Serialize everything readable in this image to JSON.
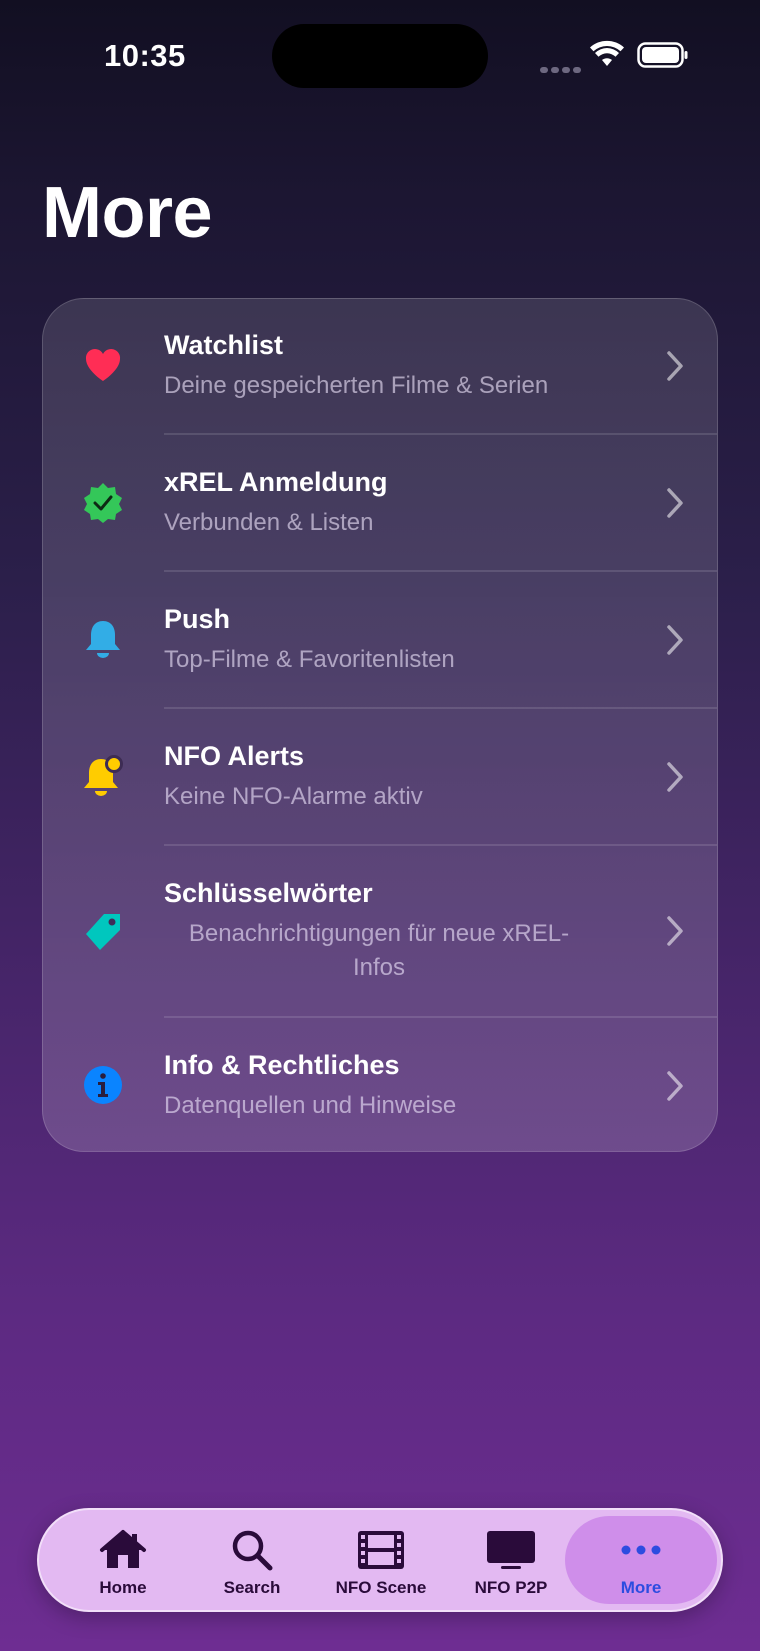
{
  "status_bar": {
    "time": "10:35",
    "icons": [
      "signal-dots-icon",
      "wifi-icon",
      "battery-icon"
    ]
  },
  "page": {
    "title": "More"
  },
  "menu": {
    "items": [
      {
        "title": "Watchlist",
        "subtitle": "Deine gespeicherten Filme & Serien",
        "icon": "heart-icon",
        "icon_color": "#ff2d55"
      },
      {
        "title": "xREL Anmeldung",
        "subtitle": "Verbunden & Listen",
        "icon": "checkmark-seal-icon",
        "icon_color": "#34c759"
      },
      {
        "title": "Push",
        "subtitle": "Top-Filme & Favoritenlisten",
        "icon": "bell-icon",
        "icon_color": "#32ade6"
      },
      {
        "title": "NFO Alerts",
        "subtitle": "Keine NFO-Alarme aktiv",
        "icon": "bell-badge-icon",
        "icon_color": "#ffcc00"
      },
      {
        "title": "Schlüsselwörter",
        "subtitle": "Benachrichtigungen für neue xREL-Infos",
        "icon": "tag-icon",
        "icon_color": "#00c7be"
      },
      {
        "title": "Info & Rechtliches",
        "subtitle": "Datenquellen und Hinweise",
        "icon": "info-circle-icon",
        "icon_color": "#0a84ff"
      }
    ]
  },
  "tab_bar": {
    "active": "More",
    "tabs": [
      {
        "label": "Home",
        "icon": "house-icon"
      },
      {
        "label": "Search",
        "icon": "magnifier-icon"
      },
      {
        "label": "NFO Scene",
        "icon": "film-icon"
      },
      {
        "label": "NFO P2P",
        "icon": "tv-icon"
      },
      {
        "label": "More",
        "icon": "ellipsis-icon"
      }
    ],
    "colors": {
      "icon": "#2a0b3a",
      "active": "#2d4ce0"
    }
  }
}
